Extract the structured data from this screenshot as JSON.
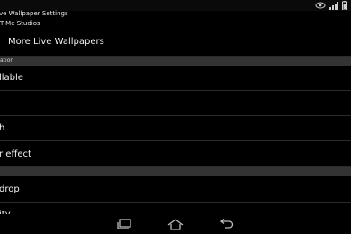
{
  "status_bar": {
    "icons": [
      "eye-icon",
      "signal-icon",
      "battery-icon"
    ]
  },
  "header": {
    "title": "ve Wallpaper Settings",
    "subtitle": "T-Me Studios"
  },
  "items": {
    "more_live_wallpapers": "More Live Wallpapers",
    "section_1": "ation",
    "row_available": "llable",
    "row_h": "h",
    "row_effect": "r effect",
    "row_drop": "drop",
    "row_partial": "ity"
  },
  "nav_bar": {
    "buttons": [
      "recent-apps-icon",
      "home-icon",
      "back-icon"
    ]
  }
}
